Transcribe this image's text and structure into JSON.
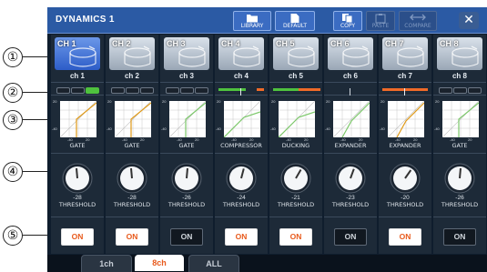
{
  "window": {
    "title": "DYNAMICS 1"
  },
  "toolbar": {
    "library": "LIBRARY",
    "default": "DEFAULT",
    "copy": "COPY",
    "paste": "PASTE",
    "compare": "COMPARE",
    "close": "✕"
  },
  "callouts": [
    "①",
    "②",
    "③",
    "④",
    "⑤"
  ],
  "colors": {
    "accent_on": "#e85a1c",
    "meter_green": "#4fc23e",
    "meter_orange": "#f06a28",
    "title_bar": "#2b5aa4"
  },
  "threshold_label": "THRESHOLD",
  "channels": [
    {
      "tag": "CH 1",
      "name": "ch 1",
      "type": "GATE",
      "threshold": "-28",
      "on": "ON",
      "on_state": true,
      "selected": true,
      "meter": "green",
      "curve": "gate"
    },
    {
      "tag": "CH 2",
      "name": "ch 2",
      "type": "GATE",
      "threshold": "-28",
      "on": "ON",
      "on_state": true,
      "selected": false,
      "meter": "none",
      "curve": "gate"
    },
    {
      "tag": "CH 3",
      "name": "ch 3",
      "type": "GATE",
      "threshold": "-26",
      "on": "ON",
      "on_state": false,
      "selected": false,
      "meter": "none",
      "curve": "gate"
    },
    {
      "tag": "CH 4",
      "name": "ch 4",
      "type": "COMPRESSOR",
      "threshold": "-24",
      "on": "ON",
      "on_state": true,
      "selected": false,
      "meter": "comp",
      "curve": "comp"
    },
    {
      "tag": "CH 5",
      "name": "ch 5",
      "type": "DUCKING",
      "threshold": "-21",
      "on": "ON",
      "on_state": true,
      "selected": false,
      "meter": "duck",
      "curve": "comp"
    },
    {
      "tag": "CH 6",
      "name": "ch 6",
      "type": "EXPANDER",
      "threshold": "-23",
      "on": "ON",
      "on_state": false,
      "selected": false,
      "meter": "line",
      "curve": "exp"
    },
    {
      "tag": "CH 7",
      "name": "ch 7",
      "type": "EXPANDER",
      "threshold": "-20",
      "on": "ON",
      "on_state": true,
      "selected": false,
      "meter": "orange",
      "curve": "exp"
    },
    {
      "tag": "CH 8",
      "name": "ch 8",
      "type": "GATE",
      "threshold": "-26",
      "on": "ON",
      "on_state": false,
      "selected": false,
      "meter": "none",
      "curve": "gate"
    }
  ],
  "graph_labels": {
    "top": "20",
    "mid": "-40",
    "bottom_left": "-40",
    "bottom_right": "20"
  },
  "tabs": [
    "1ch",
    "8ch",
    "ALL"
  ],
  "active_tab": "8ch"
}
